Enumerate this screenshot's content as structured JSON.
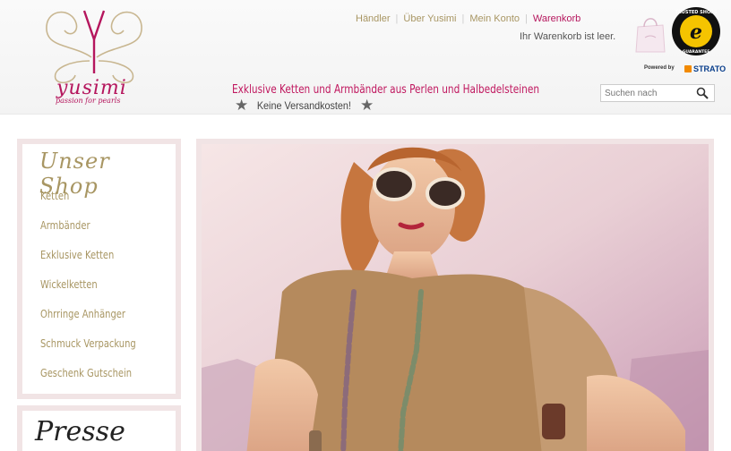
{
  "brand": {
    "name": "yusimi",
    "slogan": "passion for pearls",
    "accent": "#b5165d",
    "gold": "#a89663"
  },
  "topnav": {
    "items": [
      "Händler",
      "Über Yusimi",
      "Mein Konto"
    ],
    "cart_label": "Warenkorb"
  },
  "cart": {
    "status": "Ihr Warenkorb ist leer."
  },
  "trusted": {
    "label": "TRUSTED SHOPS",
    "sub": "GUARANTEE"
  },
  "powered": {
    "label": "Powered by",
    "provider": "STRATO"
  },
  "tagline": "Exklusive Ketten und Armbänder aus Perlen und Halbedelsteinen",
  "shipping": "Keine Versandkosten!",
  "search": {
    "placeholder": "Suchen nach"
  },
  "sidebar": {
    "title": "Unser Shop",
    "items": [
      "Ketten",
      "Armbänder",
      "Exklusive Ketten",
      "Wickelketten",
      "Ohrringe Anhänger",
      "Schmuck Verpackung",
      "Geschenk Gutschein"
    ]
  },
  "presse": {
    "title": "Presse"
  },
  "hero": {
    "alt": "model-with-sunglasses-and-necklace"
  }
}
